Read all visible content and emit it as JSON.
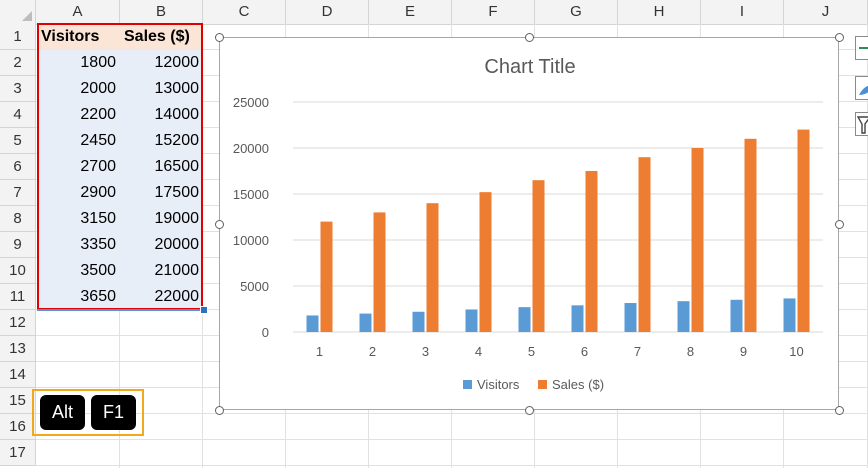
{
  "columns": [
    "A",
    "B",
    "C",
    "D",
    "E",
    "F",
    "G",
    "H",
    "I",
    "J"
  ],
  "rows": [
    "1",
    "2",
    "3",
    "4",
    "5",
    "6",
    "7",
    "8",
    "9",
    "10",
    "11",
    "12",
    "13",
    "14",
    "15",
    "16",
    "17"
  ],
  "table": {
    "headers": [
      "Visitors",
      "Sales ($)"
    ],
    "rows": [
      [
        "1800",
        "12000"
      ],
      [
        "2000",
        "13000"
      ],
      [
        "2200",
        "14000"
      ],
      [
        "2450",
        "15200"
      ],
      [
        "2700",
        "16500"
      ],
      [
        "2900",
        "17500"
      ],
      [
        "3150",
        "19000"
      ],
      [
        "3350",
        "20000"
      ],
      [
        "3500",
        "21000"
      ],
      [
        "3650",
        "22000"
      ]
    ]
  },
  "keys": [
    "Alt",
    "F1"
  ],
  "colors": {
    "visitors": "#5b9bd5",
    "sales": "#ed7d31",
    "red_box": "#e00000",
    "key_box": "#f0a91e"
  },
  "icons": {
    "chart_elements": "plus-icon",
    "chart_styles": "brush-icon",
    "chart_filters": "filter-icon"
  },
  "chart_data": {
    "type": "bar",
    "title": "Chart Title",
    "categories": [
      "1",
      "2",
      "3",
      "4",
      "5",
      "6",
      "7",
      "8",
      "9",
      "10"
    ],
    "series": [
      {
        "name": "Visitors",
        "values": [
          1800,
          2000,
          2200,
          2450,
          2700,
          2900,
          3150,
          3350,
          3500,
          3650
        ]
      },
      {
        "name": "Sales ($)",
        "values": [
          12000,
          13000,
          14000,
          15200,
          16500,
          17500,
          19000,
          20000,
          21000,
          22000
        ]
      }
    ],
    "yticks": [
      "0",
      "5000",
      "10000",
      "15000",
      "20000",
      "25000"
    ],
    "ylim": [
      0,
      25000
    ],
    "grid": true,
    "legend": "bottom"
  }
}
